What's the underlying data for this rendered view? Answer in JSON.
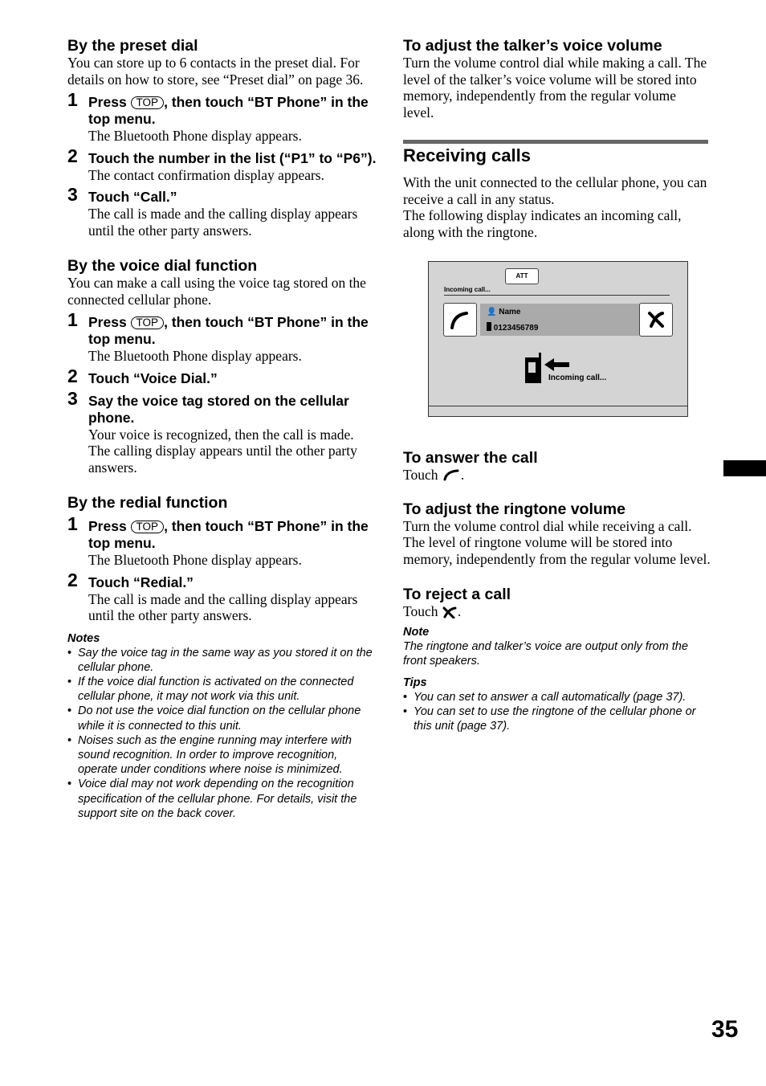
{
  "page_number": "35",
  "left": {
    "preset": {
      "heading": "By the preset dial",
      "intro": "You can store up to 6 contacts in the preset dial. For details on how to store, see “Preset dial” on page 36.",
      "steps": [
        {
          "num": "1",
          "pre": "Press ",
          "key": "TOP",
          "post": ", then touch “BT Phone” in the top menu.",
          "desc": "The Bluetooth Phone display appears."
        },
        {
          "num": "2",
          "title": "Touch the number in the list (“P1” to “P6”).",
          "desc": "The contact confirmation display appears."
        },
        {
          "num": "3",
          "title": "Touch “Call.”",
          "desc": "The call is made and the calling display appears until the other party answers."
        }
      ]
    },
    "voice": {
      "heading": "By the voice dial function",
      "intro": "You can make a call using the voice tag stored on the connected cellular phone.",
      "steps": [
        {
          "num": "1",
          "pre": "Press ",
          "key": "TOP",
          "post": ", then touch “BT Phone” in the top menu.",
          "desc": "The Bluetooth Phone display appears."
        },
        {
          "num": "2",
          "title": "Touch “Voice Dial.”"
        },
        {
          "num": "3",
          "title": "Say the voice tag stored on the cellular phone.",
          "desc": "Your voice is recognized, then the call is made.",
          "desc2": "The calling display appears until the other party answers."
        }
      ]
    },
    "redial": {
      "heading": "By the redial function",
      "steps": [
        {
          "num": "1",
          "pre": "Press ",
          "key": "TOP",
          "post": ", then touch “BT Phone” in the top menu.",
          "desc": "The Bluetooth Phone display appears."
        },
        {
          "num": "2",
          "title": "Touch “Redial.”",
          "desc": "The call is made and the calling display appears until the other party answers."
        }
      ]
    },
    "notes": {
      "title": "Notes",
      "items": [
        "Say the voice tag in the same way as you stored it on the cellular phone.",
        "If the voice dial function is activated on the connected cellular phone, it may not work via this unit.",
        "Do not use the voice dial function on the cellular phone while it is connected to this unit.",
        "Noises such as the engine running may interfere with sound recognition. In order to improve recognition, operate under conditions where noise is minimized.",
        "Voice dial may not work depending on the recognition specification of the cellular phone. For details, visit the support site on the back cover."
      ]
    }
  },
  "right": {
    "talker": {
      "heading": "To adjust the talker’s voice volume",
      "body": "Turn the volume control dial while making a call. The level of the talker’s voice volume will be stored into memory, independently from the regular volume level."
    },
    "receiving": {
      "heading": "Receiving calls",
      "p1": "With the unit connected to the cellular phone, you can receive a call in any status.",
      "p2": "The following display indicates an incoming call, along with the ringtone."
    },
    "screen": {
      "att_label": "ATT",
      "status": "Incoming call...",
      "caller_name": "Name",
      "caller_number": "0123456789",
      "incoming_label": "Incoming call...",
      "answer_icon": "phone-answer-icon",
      "reject_icon": "phone-reject-icon"
    },
    "answer": {
      "heading": "To answer the call",
      "touch": "Touch",
      "icon": "phone-answer-icon"
    },
    "ringtone": {
      "heading": "To adjust the ringtone volume",
      "p1": "Turn the volume control dial while receiving a call.",
      "p2": "The level of ringtone volume will be stored into memory, independently from the regular volume level."
    },
    "reject": {
      "heading": "To reject a call",
      "touch": "Touch",
      "icon": "phone-reject-icon"
    },
    "note": {
      "title": "Note",
      "text": "The ringtone and talker’s voice are output only from the front speakers."
    },
    "tips": {
      "title": "Tips",
      "items": [
        "You can set to answer a call automatically (page 37).",
        "You can set to use the ringtone of the cellular phone or this unit (page 37)."
      ]
    }
  }
}
